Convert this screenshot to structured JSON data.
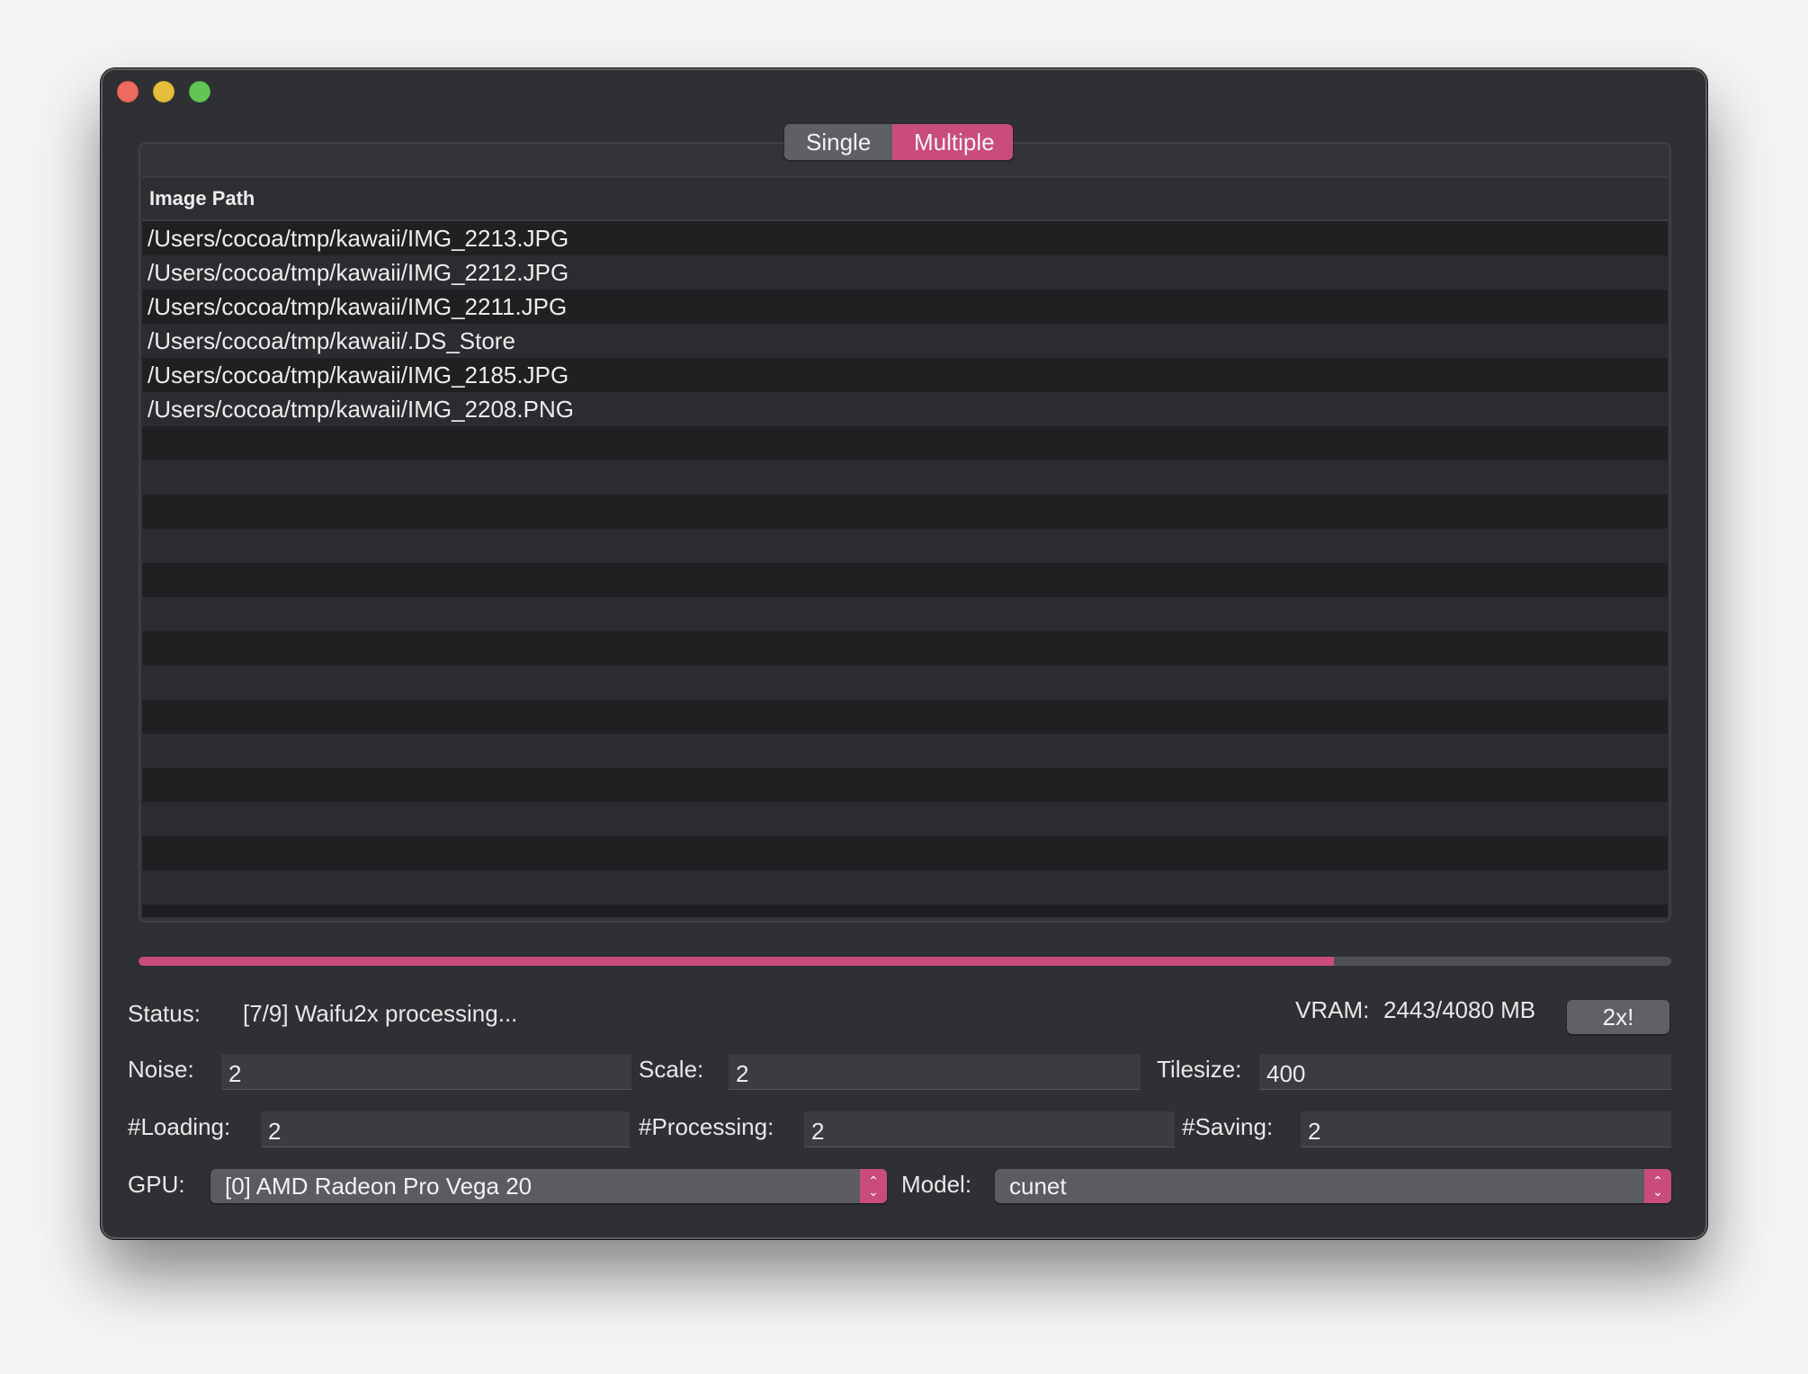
{
  "window": {
    "traffic_lights": [
      "close",
      "minimize",
      "maximize"
    ]
  },
  "mode_tabs": {
    "single_label": "Single",
    "multiple_label": "Multiple",
    "selected": "Multiple"
  },
  "table": {
    "header": "Image Path",
    "rows": [
      "/Users/cocoa/tmp/kawaii/IMG_2213.JPG",
      "/Users/cocoa/tmp/kawaii/IMG_2212.JPG",
      "/Users/cocoa/tmp/kawaii/IMG_2211.JPG",
      "/Users/cocoa/tmp/kawaii/.DS_Store",
      "/Users/cocoa/tmp/kawaii/IMG_2185.JPG",
      "/Users/cocoa/tmp/kawaii/IMG_2208.PNG"
    ]
  },
  "progress": {
    "fraction": 0.78
  },
  "status": {
    "label": "Status:",
    "text": "[7/9] Waifu2x processing...",
    "vram_label": "VRAM:",
    "vram_value": "2443/4080 MB",
    "run_button": "2x!"
  },
  "params": {
    "noise_label": "Noise:",
    "noise_value": "2",
    "scale_label": "Scale:",
    "scale_value": "2",
    "tilesize_label": "Tilesize:",
    "tilesize_value": "400",
    "loading_label": "#Loading:",
    "loading_value": "2",
    "processing_label": "#Processing:",
    "processing_value": "2",
    "saving_label": "#Saving:",
    "saving_value": "2"
  },
  "gpu": {
    "label": "GPU:",
    "selected": "[0] AMD Radeon Pro Vega 20"
  },
  "model": {
    "label": "Model:",
    "selected": "cunet"
  },
  "colors": {
    "accent": "#c94c7c",
    "window_bg": "#2f3033"
  }
}
